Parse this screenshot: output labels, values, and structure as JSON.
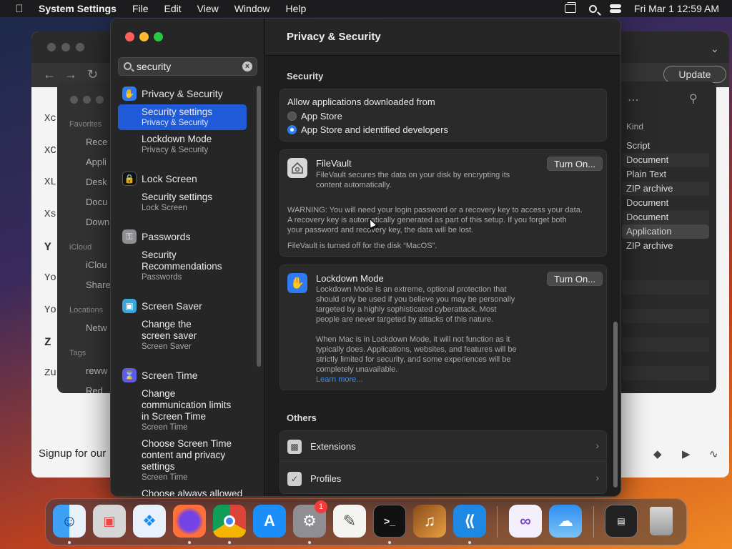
{
  "menubar": {
    "app_name": "System Settings",
    "menus": [
      "File",
      "Edit",
      "View",
      "Window",
      "Help"
    ],
    "clock": "Fri Mar 1  12:59 AM"
  },
  "background": {
    "browser_update": "Update",
    "signup_text": "Signup for our",
    "letters": [
      "Xc",
      "XC",
      "XL",
      "Xs",
      "Y",
      "Yo",
      "Yo",
      "Z",
      "Zu"
    ],
    "finder_sidebar": {
      "favorites": "Favorites",
      "fav_items": [
        "Rece",
        "Appli",
        "Desk",
        "Docu",
        "Down"
      ],
      "icloud": "iCloud",
      "icloud_items": [
        "iClou",
        "Share"
      ],
      "locations": "Locations",
      "loc_items": [
        "Netw"
      ],
      "tags": "Tags",
      "tag_items": [
        "reww",
        "Red"
      ]
    },
    "finder_kind": {
      "header": "Kind",
      "rows": [
        "Script",
        "Document",
        "Plain Text",
        "ZIP archive",
        "Document",
        "Document",
        "Application",
        "ZIP archive"
      ]
    }
  },
  "settings": {
    "search": {
      "value": "security",
      "placeholder": "Search"
    },
    "sidebar": [
      {
        "category": "Privacy & Security",
        "results": [
          {
            "title": "Security settings",
            "subtitle": "Privacy & Security",
            "selected": true
          },
          {
            "title": "Lockdown Mode",
            "subtitle": "Privacy & Security"
          }
        ]
      },
      {
        "category": "Lock Screen",
        "results": [
          {
            "title": "Security settings",
            "subtitle": "Lock Screen"
          }
        ]
      },
      {
        "category": "Passwords",
        "results": [
          {
            "title": "Security Recommendations",
            "subtitle": "Passwords"
          }
        ]
      },
      {
        "category": "Screen Saver",
        "results": [
          {
            "title": "Change the screen saver",
            "subtitle": "Screen Saver"
          }
        ]
      },
      {
        "category": "Screen Time",
        "results": [
          {
            "title": "Change communication limits in Screen Time",
            "subtitle": "Screen Time"
          },
          {
            "title": "Choose Screen Time content and privacy settings",
            "subtitle": "Screen Time"
          },
          {
            "title": "Choose always allowed",
            "subtitle": ""
          }
        ]
      }
    ],
    "main": {
      "title": "Privacy & Security",
      "security_section": "Security",
      "allow_label": "Allow applications downloaded from",
      "radio_app_store": "App Store",
      "radio_app_store_dev": "App Store and identified developers",
      "filevault": {
        "title": "FileVault",
        "desc_line1": "FileVault secures the data on your disk by encrypting its",
        "desc_line2": "content automatically.",
        "button": "Turn On...",
        "warn_line1": "WARNING: You will need your login password or a recovery key to access your data.",
        "warn_line2": "A recovery key is automatically generated as part of this setup. If you forget both",
        "warn_line3": "your password and recovery key, the data will be lost.",
        "status": "FileVault is turned off for the disk “MacOS”."
      },
      "lockdown": {
        "title": "Lockdown Mode",
        "button": "Turn On...",
        "desc": [
          "Lockdown Mode is an extreme, optional protection that",
          "should only be used if you believe you may be personally",
          "targeted by a highly sophisticated cyberattack. Most",
          "people are never targeted by attacks of this nature."
        ],
        "desc2": [
          "When Mac is in Lockdown Mode, it will not function as it",
          "typically does. Applications, websites, and features will be",
          "strictly limited for security, and some experiences will be",
          "completely unavailable."
        ],
        "learn_more": "Learn more..."
      },
      "others_section": "Others",
      "others": [
        "Extensions",
        "Profiles"
      ]
    }
  },
  "dock": {
    "badge_count": "1",
    "apps": [
      "Finder",
      "Launchpad",
      "Safari",
      "Firefox",
      "Chrome",
      "App Store",
      "System Settings",
      "TextEdit",
      "Terminal",
      "Instruments",
      "VS Code",
      "Visual Studio",
      "Weather",
      "Screen",
      "Trash"
    ]
  }
}
